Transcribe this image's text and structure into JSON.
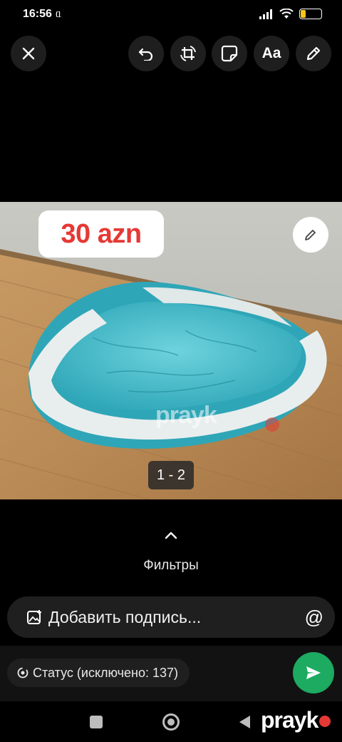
{
  "status_bar": {
    "time": "16:56",
    "carrier_icon": "ᥲ",
    "battery": "25",
    "battery_level": 0.25,
    "icons": [
      "signal-icon",
      "wifi-icon",
      "battery-icon"
    ]
  },
  "toolbar": {
    "buttons": [
      "close-icon",
      "undo-icon",
      "crop-rotate-icon",
      "sticker-icon",
      "text-tool-icon",
      "pencil-icon"
    ],
    "text_tool_label": "Aa"
  },
  "photo": {
    "price_badge": "30 azn",
    "watermark": "prayk",
    "page_indicator": "1 - 2"
  },
  "filters": {
    "label": "Фильтры"
  },
  "caption": {
    "placeholder": "Добавить подпись...",
    "mention_symbol": "@"
  },
  "status": {
    "label": "Статус (исключено: 137)"
  },
  "nav": {
    "brand": "prayk"
  },
  "colors": {
    "accent_send": "#1daa61",
    "price_red": "#e53935",
    "battery_yellow": "#f5c518"
  }
}
